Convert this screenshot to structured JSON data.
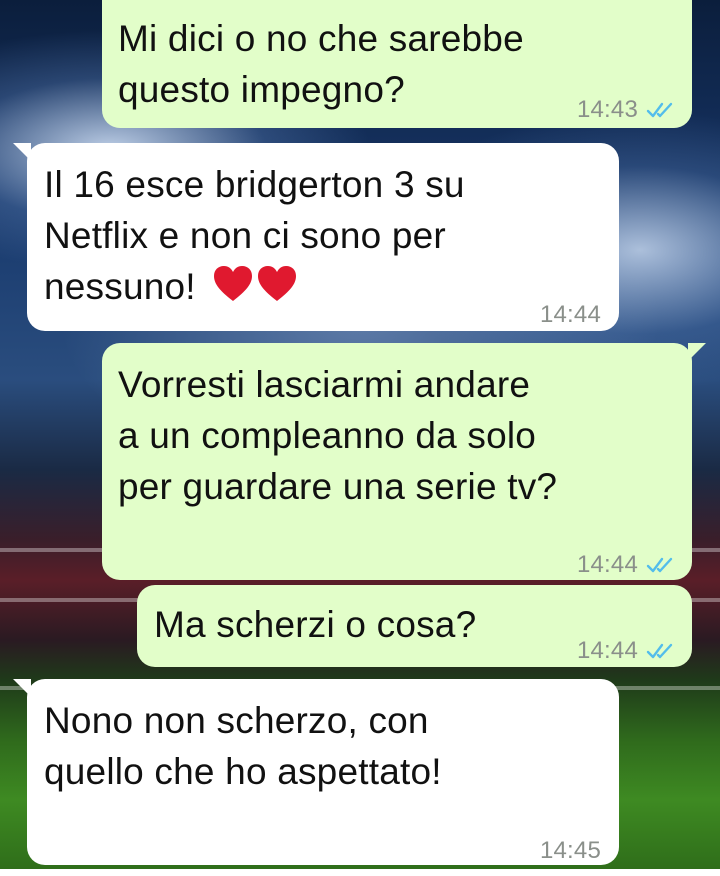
{
  "messages": [
    {
      "direction": "outgoing",
      "text": "Mi dici o no che sarebbe\nquesto impegno?",
      "time": "14:43",
      "status": "read-double-check-icon"
    },
    {
      "direction": "incoming",
      "text": "Il 16 esce bridgerton 3 su\nNetflix e non ci sono per\nnessuno! ",
      "emoji": "red-heart-icon x2",
      "time": "14:44"
    },
    {
      "direction": "outgoing",
      "text": "Vorresti lasciarmi andare\na un compleanno da solo\nper guardare una serie tv?",
      "time": "14:44",
      "status": "read-double-check-icon"
    },
    {
      "direction": "outgoing",
      "text": "Ma scherzi o cosa?",
      "time": "14:44",
      "status": "read-double-check-icon"
    },
    {
      "direction": "incoming",
      "text": "Nono non scherzo, con\nquello che ho aspettato!",
      "time": "14:45"
    }
  ],
  "colors": {
    "outgoing_bubble": "#e2fec9",
    "incoming_bubble": "#ffffff",
    "read_check": "#53bdeb",
    "timestamp": "#8a8f8a"
  }
}
